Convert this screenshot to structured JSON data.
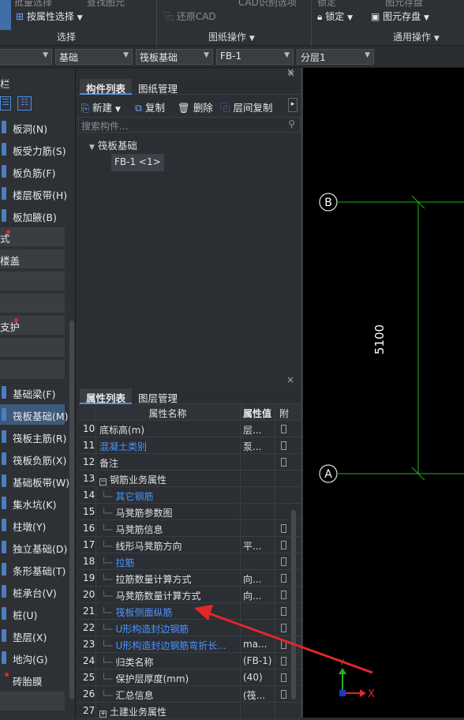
{
  "ribbon": {
    "top_items": [
      "批量选择",
      "查找图元",
      "CAD识别选项",
      "锁定",
      "图元存盘"
    ],
    "select_by_attr": "按属性选择",
    "restore_cad": "还原CAD",
    "lock": "锁定",
    "save": "图元存盘",
    "group_select": "选择",
    "group_drawing": "图纸操作",
    "group_common": "通用操作"
  },
  "combos": [
    "",
    "基础",
    "筏板基础",
    "FB-1",
    "分层1"
  ],
  "left_panel": {
    "title": "栏",
    "items_top": [
      {
        "label": "板洞(N)"
      },
      {
        "label": "板受力筋(S)"
      },
      {
        "label": "板负筋(F)"
      },
      {
        "label": "楼层板带(H)"
      },
      {
        "label": "板加腋(B)"
      }
    ],
    "sections": [
      "式",
      "楼盖",
      "",
      "",
      "支护",
      "",
      ""
    ],
    "items_bottom": [
      {
        "label": "基础梁(F)"
      },
      {
        "label": "筏板基础(M)"
      },
      {
        "label": "筏板主筋(R)"
      },
      {
        "label": "筏板负筋(X)"
      },
      {
        "label": "基础板带(W)"
      },
      {
        "label": "集水坑(K)"
      },
      {
        "label": "柱墩(Y)"
      },
      {
        "label": "独立基础(D)"
      },
      {
        "label": "条形基础(T)"
      },
      {
        "label": "桩承台(V)"
      },
      {
        "label": "桩(U)"
      },
      {
        "label": "垫层(X)"
      },
      {
        "label": "地沟(G)"
      },
      {
        "label": "砖胎膜"
      }
    ]
  },
  "component_panel": {
    "tabs": [
      "构件列表",
      "图纸管理"
    ],
    "toolbar": [
      "新建",
      "复制",
      "删除",
      "层间复制"
    ],
    "search_placeholder": "搜索构件...",
    "tree_root": "筏板基础",
    "tree_child": "FB-1 <1>"
  },
  "props_panel": {
    "tabs": [
      "属性列表",
      "图层管理"
    ],
    "headers": [
      "属性名称",
      "属性值",
      "附"
    ],
    "rows": [
      {
        "num": "10",
        "name": "底标高(m)",
        "value": "层...",
        "blue": false,
        "check": true
      },
      {
        "num": "11",
        "name": "混凝土类别",
        "value": "泵...",
        "blue": true,
        "check": true
      },
      {
        "num": "12",
        "name": "备注",
        "value": "",
        "blue": false,
        "check": true
      },
      {
        "num": "13",
        "name": "钢筋业务属性",
        "value": "",
        "blue": false,
        "check": false
      },
      {
        "num": "14",
        "name": "其它钢筋",
        "value": "",
        "blue": true,
        "check": false
      },
      {
        "num": "15",
        "name": "马凳筋参数图",
        "value": "",
        "blue": false,
        "check": false
      },
      {
        "num": "16",
        "name": "马凳筋信息",
        "value": "",
        "blue": false,
        "check": true
      },
      {
        "num": "17",
        "name": "线形马凳筋方向",
        "value": "平...",
        "blue": false,
        "check": true
      },
      {
        "num": "18",
        "name": "拉筋",
        "value": "",
        "blue": true,
        "check": true
      },
      {
        "num": "19",
        "name": "拉筋数量计算方式",
        "value": "向...",
        "blue": false,
        "check": true
      },
      {
        "num": "20",
        "name": "马凳筋数量计算方式",
        "value": "向...",
        "blue": false,
        "check": true
      },
      {
        "num": "21",
        "name": "筏板侧面纵筋",
        "value": "",
        "blue": true,
        "check": true
      },
      {
        "num": "22",
        "name": "U形构造封边钢筋",
        "value": "",
        "blue": true,
        "check": true
      },
      {
        "num": "23",
        "name": "U形构造封边钢筋弯折长...",
        "value": "ma...",
        "blue": true,
        "check": true
      },
      {
        "num": "24",
        "name": "归类名称",
        "value": "(FB-1)",
        "blue": false,
        "check": true
      },
      {
        "num": "25",
        "name": "保护层厚度(mm)",
        "value": "(40)",
        "blue": false,
        "check": true
      },
      {
        "num": "26",
        "name": "汇总信息",
        "value": "(筏...",
        "blue": false,
        "check": true
      },
      {
        "num": "27",
        "name": "土建业务属性",
        "value": "",
        "blue": false,
        "check": false
      }
    ]
  },
  "cad": {
    "axis_b": "B",
    "axis_a": "A",
    "dimension": "5100",
    "x_axis": "X",
    "y_axis": "Y"
  },
  "colors": {
    "accent": "#4a90e2",
    "link_blue": "#4c95ff",
    "cad_green": "#1fb31f",
    "arrow_red": "#e3262c"
  }
}
